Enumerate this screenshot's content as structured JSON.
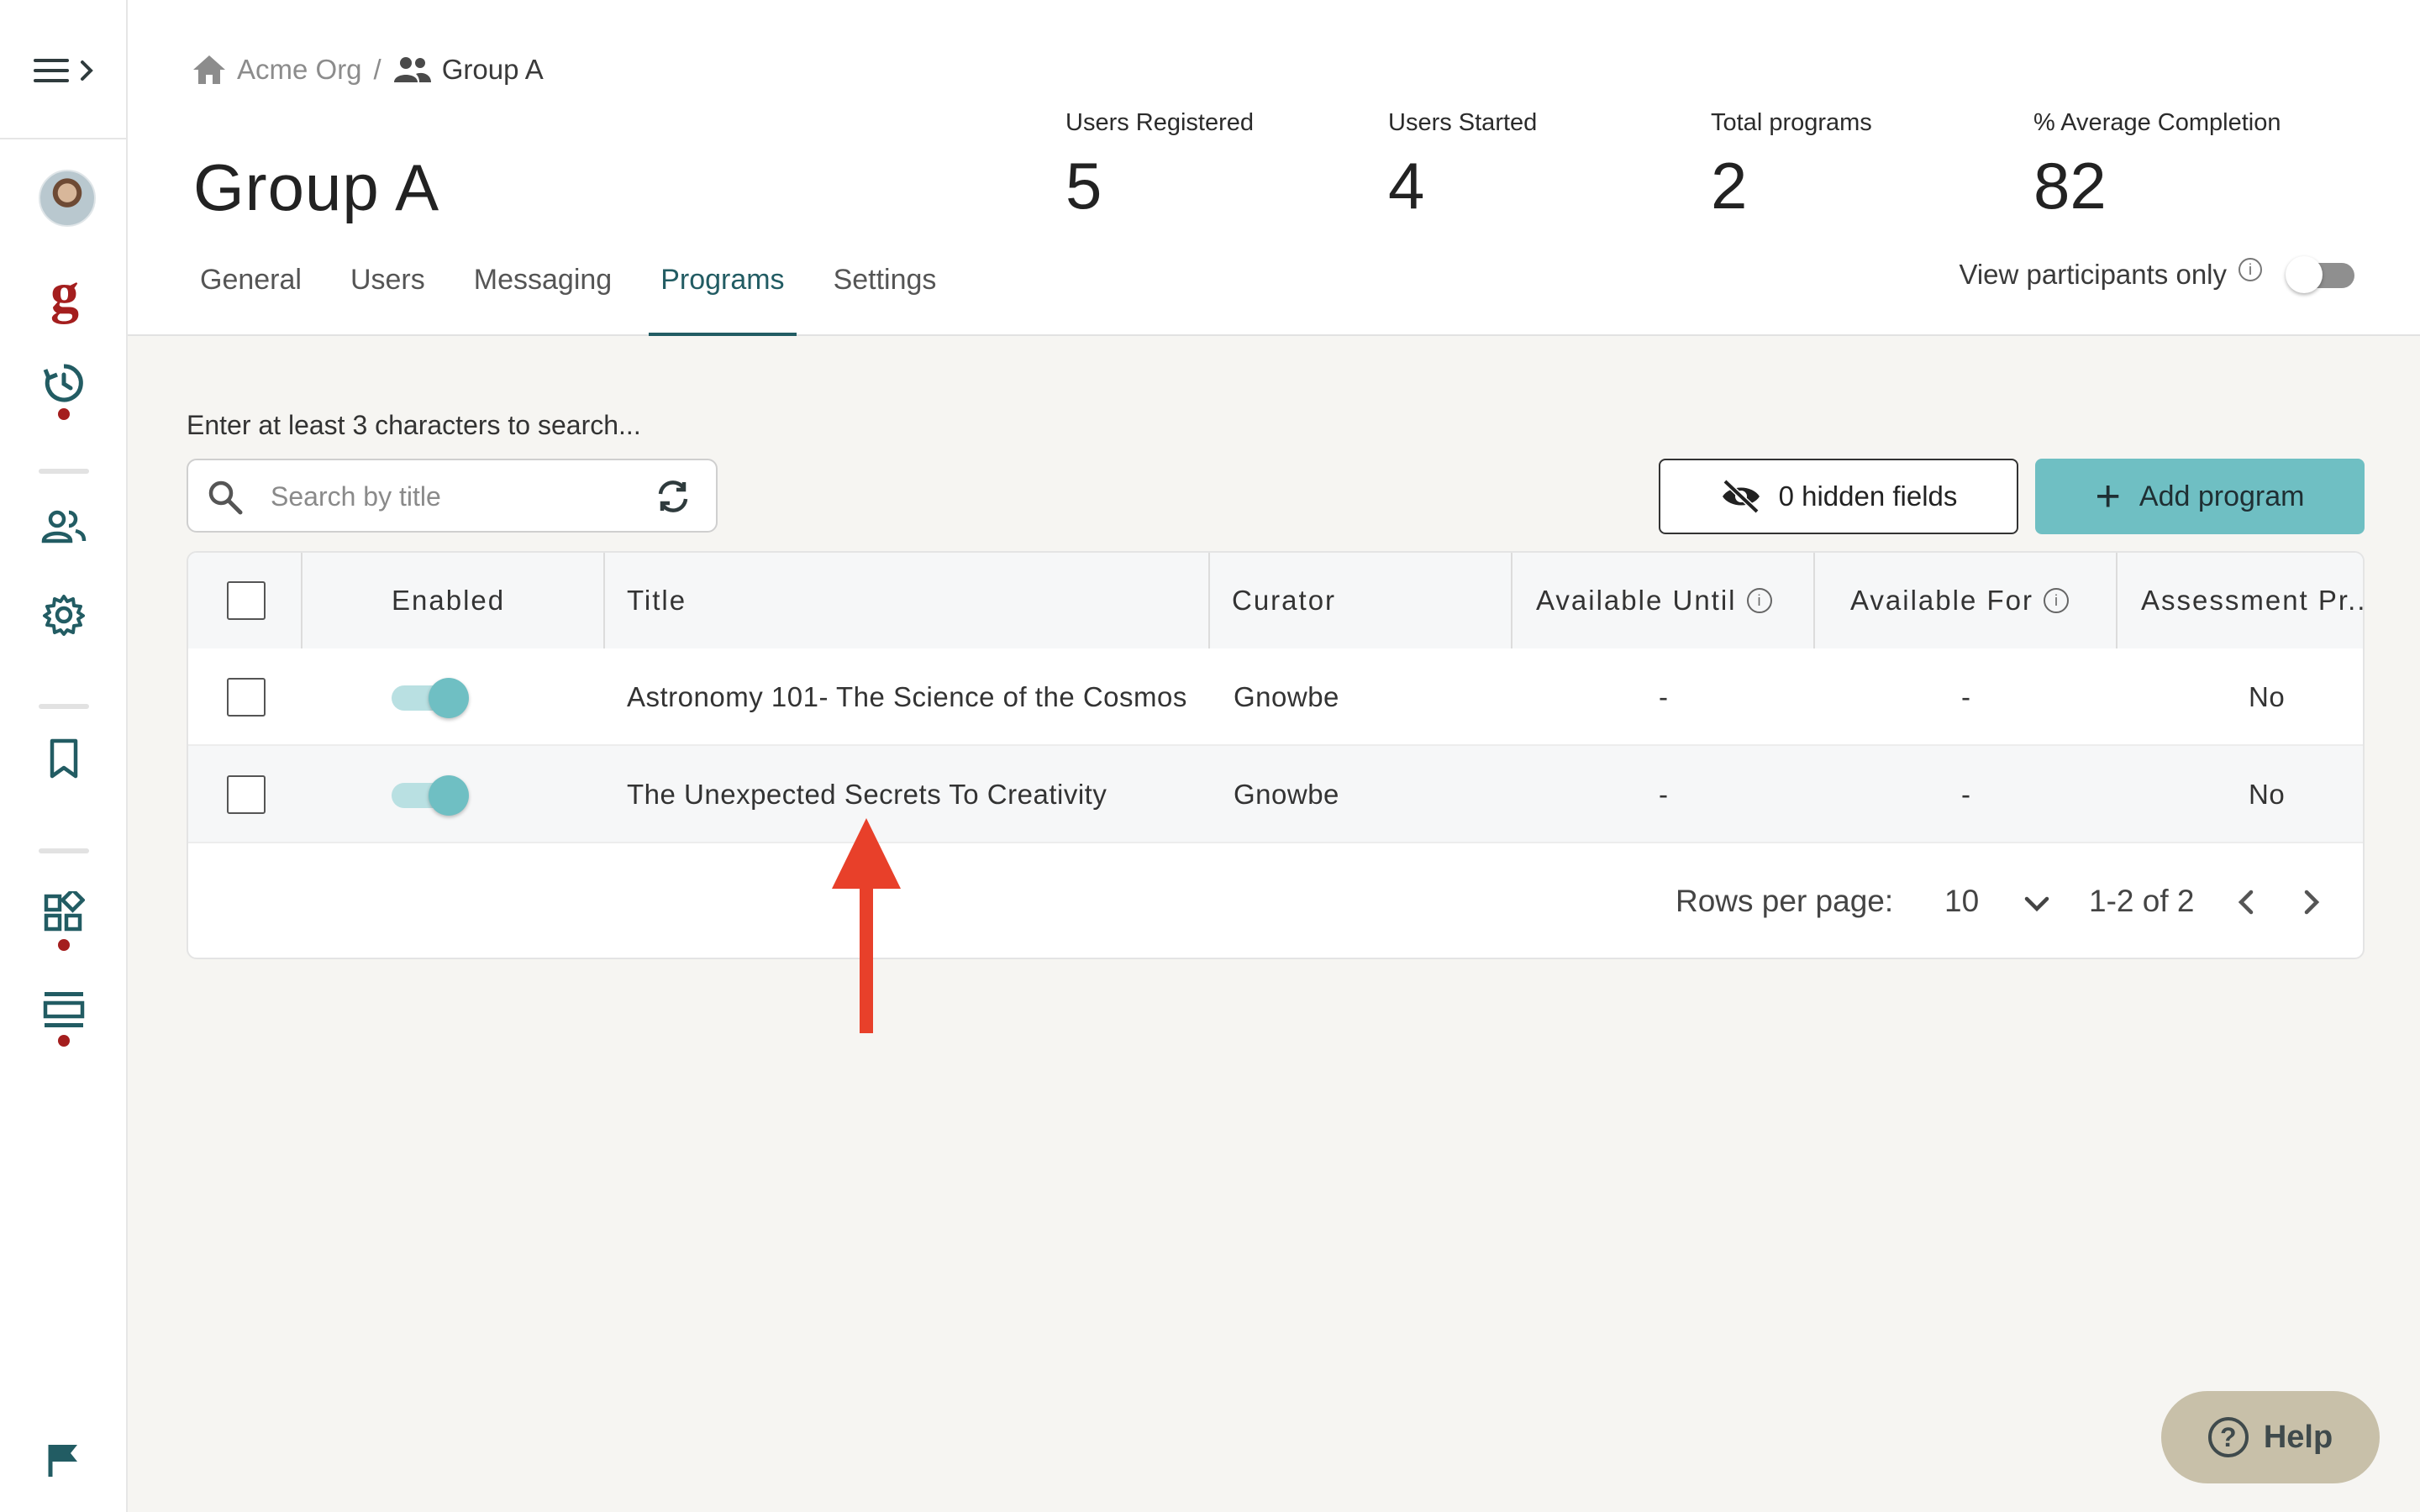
{
  "sidebar": {
    "items": [
      {
        "name": "avatar"
      },
      {
        "name": "gnowbe-logo",
        "glyph": "g"
      },
      {
        "name": "history-icon"
      },
      {
        "name": "users-icon"
      },
      {
        "name": "gear-icon"
      },
      {
        "name": "bookmark-icon"
      },
      {
        "name": "widgets-icon"
      },
      {
        "name": "layout-icon"
      },
      {
        "name": "flag-icon"
      }
    ],
    "logo_glyph": "g",
    "colors": {
      "accent": "#225c63",
      "dot": "#a41e1e"
    }
  },
  "breadcrumb": {
    "root": "Acme Org",
    "separator": "/",
    "current": "Group A"
  },
  "page_title": "Group A",
  "stats": [
    {
      "label": "Users Registered",
      "value": "5"
    },
    {
      "label": "Users Started",
      "value": "4"
    },
    {
      "label": "Total programs",
      "value": "2"
    },
    {
      "label": "% Average Completion",
      "value": "82"
    }
  ],
  "tabs": [
    {
      "label": "General",
      "active": false
    },
    {
      "label": "Users",
      "active": false
    },
    {
      "label": "Messaging",
      "active": false
    },
    {
      "label": "Programs",
      "active": true
    },
    {
      "label": "Settings",
      "active": false
    }
  ],
  "participants_toggle": {
    "label": "View participants only",
    "on": false
  },
  "search": {
    "hint": "Enter at least 3 characters to search...",
    "placeholder": "Search by title",
    "value": ""
  },
  "toolbar": {
    "hidden_fields_label": "0 hidden fields",
    "add_program_label": "Add program"
  },
  "table": {
    "columns": [
      "Enabled",
      "Title",
      "Curator",
      "Available Until",
      "Available For",
      "Assessment Pr..."
    ],
    "rows": [
      {
        "enabled": true,
        "title": "Astronomy 101- The Science of the Cosmos",
        "curator": "Gnowbe",
        "available_until": "-",
        "available_for": "-",
        "assessment": "No"
      },
      {
        "enabled": true,
        "title": "The Unexpected Secrets To Creativity",
        "curator": "Gnowbe",
        "available_until": "-",
        "available_for": "-",
        "assessment": "No"
      }
    ],
    "pagination": {
      "rows_per_page_label": "Rows per page:",
      "rows_per_page": "10",
      "range": "1-2 of 2"
    }
  },
  "help": {
    "label": "Help"
  },
  "colors": {
    "primary_button": "#6fbfc3",
    "annotation_arrow": "#e8402a",
    "help_bg": "#c8c0a9"
  }
}
